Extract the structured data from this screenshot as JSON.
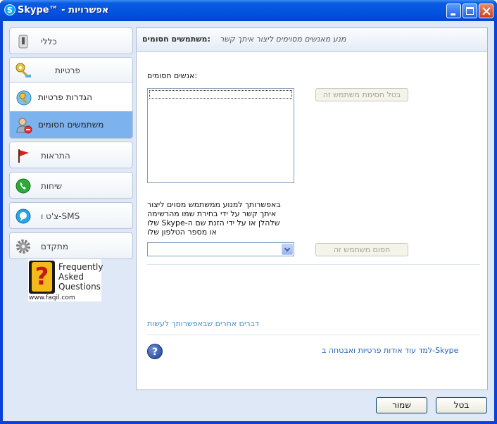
{
  "window": {
    "title": "Skype™ - אפשרויות",
    "logo_letter": "S"
  },
  "sidebar": {
    "general_label": "כללי",
    "privacy_label": "פרטיות",
    "privacy_settings_label": "הגדרות פרטיות",
    "blocked_users_label": "משתמשים חסומים",
    "notifications_label": "התראות",
    "calls_label": "שיחות",
    "sms_label": "צ'ט ו-SMS",
    "advanced_label": "מתקדם",
    "selected_item": "משתמשים חסומים"
  },
  "faq": {
    "glyph": "?",
    "line1": "Frequently",
    "line2": "Asked",
    "line3": "Questions",
    "url": "www.faqil.com"
  },
  "main": {
    "header_title": "משתמשים חסומים:",
    "header_subtitle": "מנע מאנשים מסוימים ליצור איתך קשר",
    "blocked_list_label": "אנשים חסומים:",
    "unblock_button": "בטל חסימת משתמש זה",
    "description_line1": "באפשרותך למנוע ממשתמש מסוים ליצור",
    "description_line2": "איתך קשר על ידי בחירת שמו מהרשימה",
    "description_line3": "שלו Skype-שלהלן או על ידי הזנת שם ה",
    "description_line4": "או מספר הטלפון שלו",
    "block_button": "חסום משתמש זה",
    "other_things_link": "דברים אחרים שבאפשרותך לעשות",
    "help_glyph": "?",
    "learn_more_link": "למד עוד אודות פרטיות ואבטחה ב-Skype"
  },
  "footer": {
    "save_label": "שמור",
    "cancel_label": "בטל"
  },
  "colors": {
    "selected_bg": "#7cb2ee",
    "link": "#2466b1",
    "titlebar": "#0452e0"
  }
}
